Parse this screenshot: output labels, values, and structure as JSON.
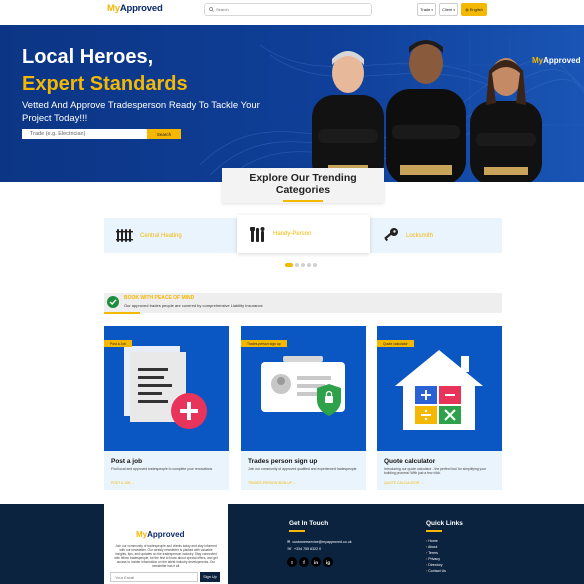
{
  "header": {
    "logo_my": "My",
    "logo_approved": "Approved",
    "search_placeholder": "Search",
    "trade_label": "Trade",
    "client_label": "Client",
    "language_label": "English"
  },
  "hero": {
    "title_line1": "Local Heroes,",
    "title_line2": "Expert Standards",
    "tagline": "Vetted And Approve Tradesperson Ready To Tackle Your Project Today!!!",
    "search_placeholder": "Trade (e.g. Electrician)",
    "search_button": "Search",
    "logo_my": "My",
    "logo_approved": "Approved"
  },
  "trending": {
    "title": "Explore Our Trending Categories",
    "categories": [
      {
        "label": "Central Heating",
        "icon": "radiator-icon"
      },
      {
        "label": "Handy-Person",
        "icon": "tools-icon"
      },
      {
        "label": "Locksmith",
        "icon": "key-icon"
      }
    ],
    "active_index": 1,
    "dots": 5,
    "active_dot": 0
  },
  "peace": {
    "title": "BOOK WITH PEACE OF MIND",
    "text": "Our approved trades people are covered by comprehensive Liability Insurance"
  },
  "features": [
    {
      "badge": "Post a Job",
      "title": "Post a job",
      "desc": "Find local and approved tradespeople to complete your renovations",
      "link": "POST A JOB →"
    },
    {
      "badge": "Trades person sign up",
      "title": "Trades person sign up",
      "desc": "Join our community of approved qualified and experienced tradespeople.",
      "link": "TRADES PERSON SIGN UP →"
    },
    {
      "badge": "Quote calculator",
      "title": "Quote calculator",
      "desc": "Introducing our quote calculator - the perfect tool for simplifying your building process! With just a few click.",
      "link": "QUOTE CALCULATOR →"
    }
  ],
  "footer": {
    "logo_my": "My",
    "logo_approved": "Approved",
    "about": "Join our community of tradespeople and clients today and stay informed with our newsletter. Our weekly newsletter is packed with valuable insights, tips, and updates on the tradesperson industry. Stay connected with fellow tradespeople, be the first to know about special offers, and get access to insider information on the latest industry developments. Our newsletter has it all.",
    "email_placeholder": "Your Email",
    "signup_button": "Sign Up",
    "get_in_touch_title": "Get In Touch",
    "email": "customerservice@myapproved.co.uk",
    "phone": "+334 755 6322 0",
    "socials": [
      "t",
      "f",
      "in",
      "ig"
    ],
    "quick_links_title": "Quick Links",
    "quick_links": [
      "Home",
      "About",
      "Terms",
      "Privacy",
      "Directory",
      "Contact Us"
    ]
  },
  "colors": {
    "accent": "#f5b800",
    "hero_bg": "#0f3a8e",
    "navy": "#0c2340",
    "card_blue": "#0a56c2",
    "light_blue": "#eaf4fc"
  }
}
